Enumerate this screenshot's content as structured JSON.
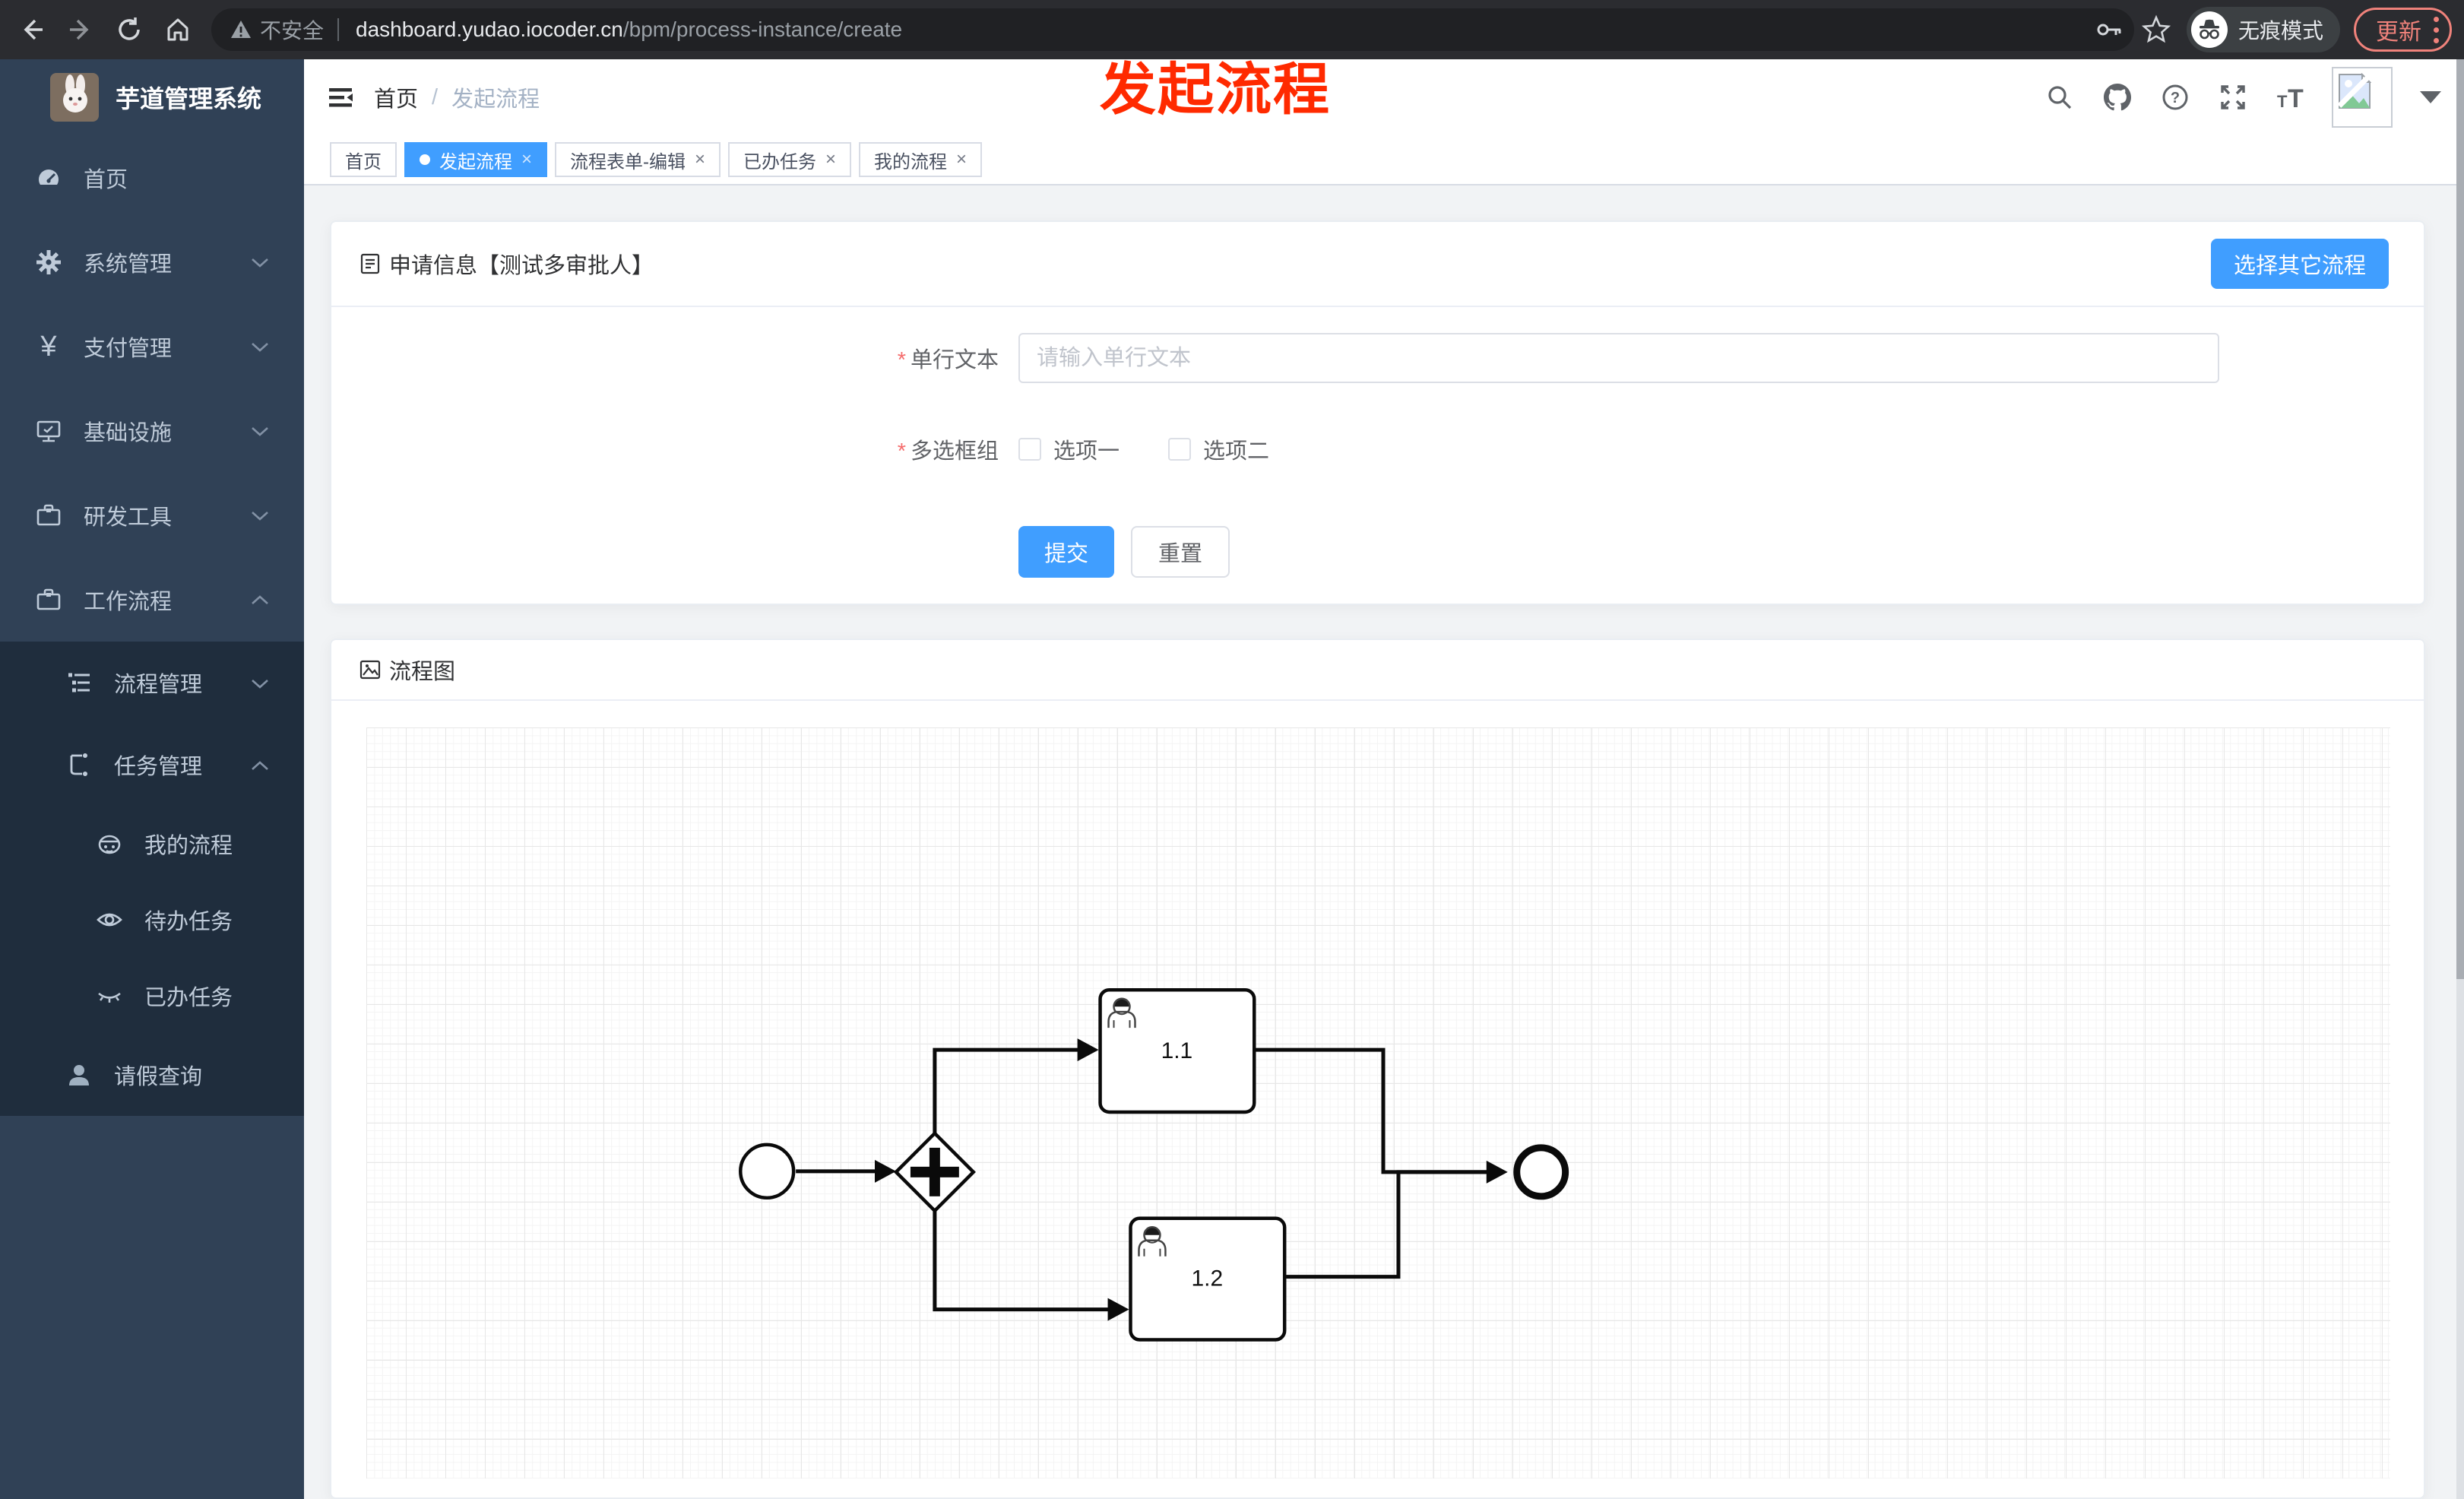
{
  "browser": {
    "security_label": "不安全",
    "url_host": "dashboard.yudao.iocoder.cn",
    "url_path": "/bpm/process-instance/create",
    "incognito_label": "无痕模式",
    "update_label": "更新"
  },
  "annotation": {
    "text": "发起流程"
  },
  "sidebar": {
    "app_title": "芋道管理系统",
    "items": [
      {
        "label": "首页",
        "icon": "dashboard-icon"
      },
      {
        "label": "系统管理",
        "icon": "gear-icon"
      },
      {
        "label": "支付管理",
        "icon": "yen-icon"
      },
      {
        "label": "基础设施",
        "icon": "monitor-icon"
      },
      {
        "label": "研发工具",
        "icon": "toolbox-icon"
      },
      {
        "label": "工作流程",
        "icon": "briefcase-icon"
      },
      {
        "label": "流程管理",
        "icon": "tree-icon"
      },
      {
        "label": "任务管理",
        "icon": "flow-icon"
      },
      {
        "label": "我的流程",
        "icon": "robot-icon"
      },
      {
        "label": "待办任务",
        "icon": "eye-open-icon"
      },
      {
        "label": "已办任务",
        "icon": "eye-closed-icon"
      },
      {
        "label": "请假查询",
        "icon": "user-icon"
      }
    ]
  },
  "header": {
    "breadcrumb": [
      "首页",
      "发起流程"
    ],
    "separator": "/"
  },
  "tabs": [
    {
      "label": "首页",
      "active": false,
      "closable": false
    },
    {
      "label": "发起流程",
      "active": true,
      "closable": true
    },
    {
      "label": "流程表单-编辑",
      "active": false,
      "closable": true
    },
    {
      "label": "已办任务",
      "active": false,
      "closable": true
    },
    {
      "label": "我的流程",
      "active": false,
      "closable": true
    }
  ],
  "form_card": {
    "title": "申请信息【测试多审批人】",
    "select_other_button": "选择其它流程",
    "fields": [
      {
        "label": "单行文本",
        "required": true,
        "placeholder": "请输入单行文本",
        "value": ""
      },
      {
        "label": "多选框组",
        "required": true,
        "options": [
          "选项一",
          "选项二"
        ],
        "checked": [
          false,
          false
        ]
      }
    ],
    "submit_button": "提交",
    "reset_button": "重置"
  },
  "flow_card": {
    "title": "流程图",
    "diagram": {
      "type": "bpmn",
      "nodes": [
        {
          "id": "start",
          "kind": "start-event"
        },
        {
          "id": "gateway",
          "kind": "parallel-gateway"
        },
        {
          "id": "task1",
          "kind": "user-task",
          "label": "1.1"
        },
        {
          "id": "task2",
          "kind": "user-task",
          "label": "1.2"
        },
        {
          "id": "end",
          "kind": "end-event"
        }
      ],
      "flows": [
        "start→gateway",
        "gateway→task1",
        "gateway→task2",
        "task1→end",
        "task2→end"
      ]
    }
  },
  "ui_glyphs": {
    "close": "×",
    "asterisk": "*",
    "star": "☆",
    "yen": "¥"
  },
  "colors": {
    "primary": "#409eff",
    "sidebar_bg": "#304156",
    "submenu_bg": "#1f2d3d",
    "sidebar_text": "#bfcbd9",
    "annotation_red": "#ff2a00"
  }
}
